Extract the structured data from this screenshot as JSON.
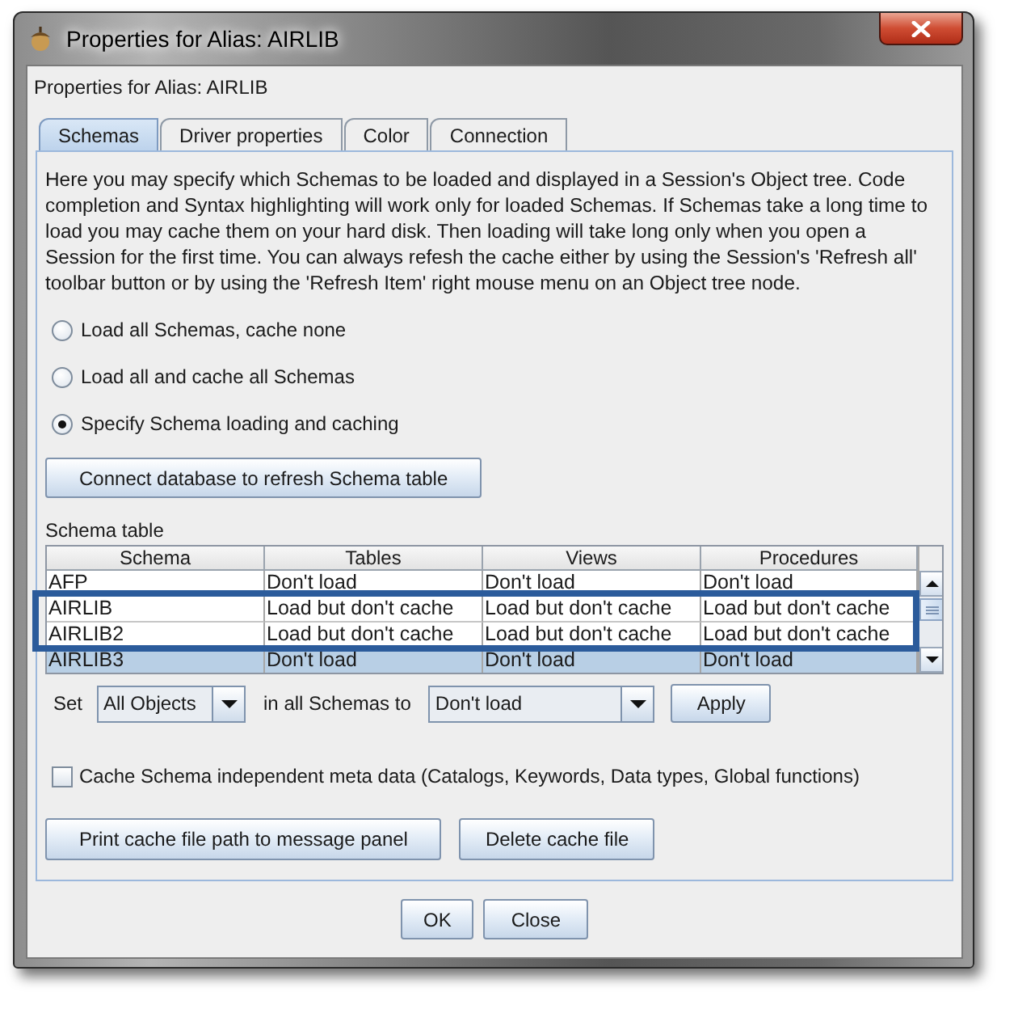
{
  "window": {
    "title": "Properties for Alias: AIRLIB"
  },
  "dialog_heading": "Properties for Alias: AIRLIB",
  "tabs": [
    {
      "label": "Schemas",
      "selected": true
    },
    {
      "label": "Driver properties",
      "selected": false
    },
    {
      "label": "Color",
      "selected": false
    },
    {
      "label": "Connection",
      "selected": false
    }
  ],
  "description": "Here you may specify which Schemas to be loaded and displayed in a Session's Object tree. Code completion and Syntax highlighting will work only for loaded Schemas. If Schemas take a long time to load you may cache them on your hard disk. Then loading will take long only when you open a Session for the first time. You can always refesh the cache either by using the Session's 'Refresh all' toolbar button or by using the 'Refresh Item' right mouse menu on an Object tree node.",
  "load_options": [
    {
      "label": "Load all Schemas, cache none",
      "selected": false
    },
    {
      "label": "Load all and cache all Schemas",
      "selected": false
    },
    {
      "label": "Specify Schema loading and caching",
      "selected": true
    }
  ],
  "connect_button": "Connect database to refresh Schema table",
  "schema_table": {
    "title": "Schema table",
    "columns": [
      "Schema",
      "Tables",
      "Views",
      "Procedures"
    ],
    "rows": [
      {
        "cells": [
          "AFP",
          "Don't load",
          "Don't load",
          "Don't load"
        ],
        "selected": false,
        "highlighted": false
      },
      {
        "cells": [
          "AIRLIB",
          "Load but don't cache",
          "Load but don't cache",
          "Load but don't cache"
        ],
        "selected": false,
        "highlighted": true
      },
      {
        "cells": [
          "AIRLIB2",
          "Load but don't cache",
          "Load but don't cache",
          "Load but don't cache"
        ],
        "selected": false,
        "highlighted": true
      },
      {
        "cells": [
          "AIRLIB3",
          "Don't load",
          "Don't load",
          "Don't load"
        ],
        "selected": true,
        "highlighted": false
      }
    ]
  },
  "set_row": {
    "label_before": "Set",
    "object_type": "All Objects",
    "label_middle": "in all Schemas to",
    "load_mode": "Don't load",
    "apply_button": "Apply"
  },
  "cache_meta_checkbox": {
    "label": "Cache Schema independent meta data (Catalogs, Keywords, Data types, Global functions)",
    "checked": false
  },
  "panel_buttons": [
    "Print cache file path to message panel",
    "Delete cache file"
  ],
  "dialog_buttons": [
    "OK",
    "Close"
  ]
}
